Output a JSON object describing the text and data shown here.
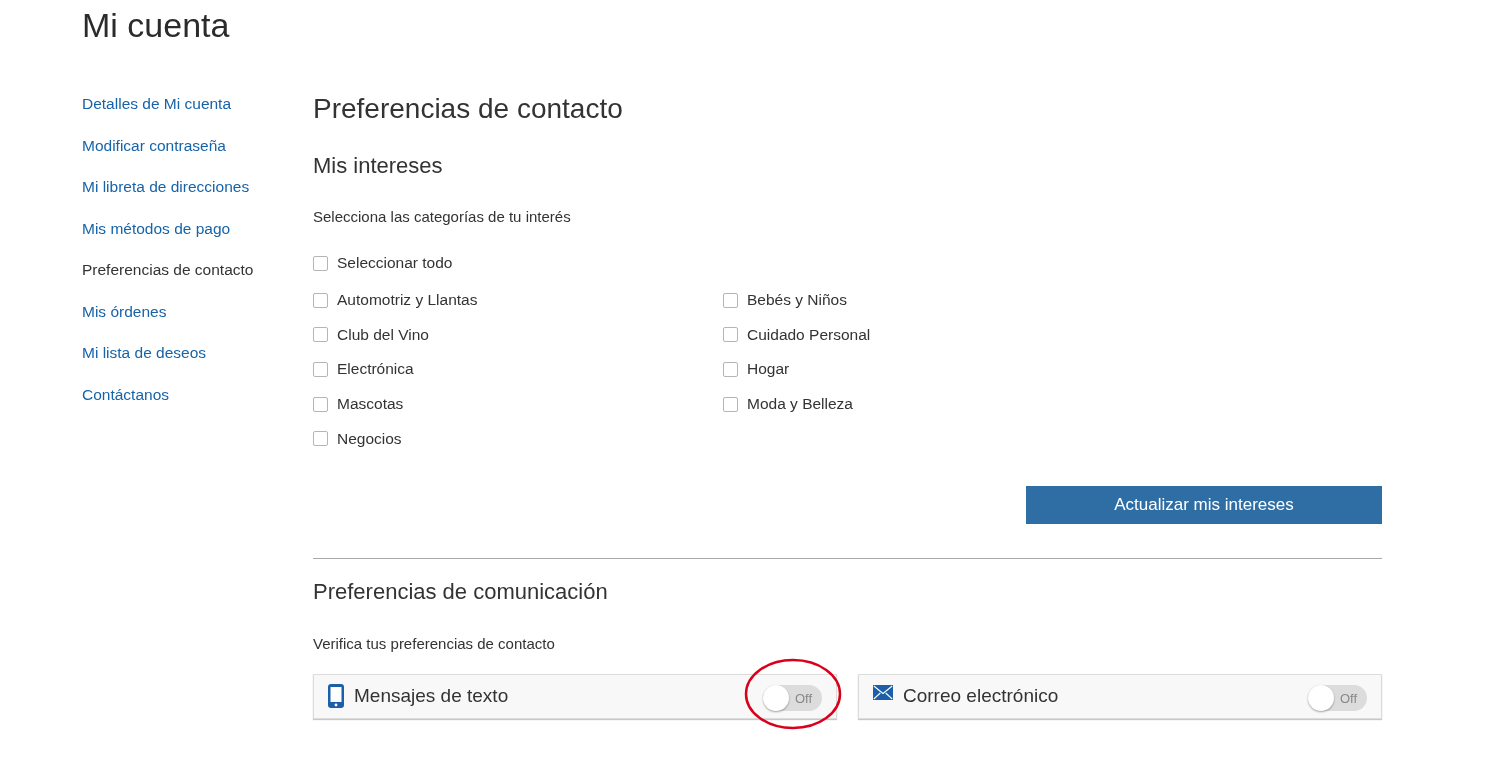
{
  "page": {
    "title": "Mi cuenta"
  },
  "sidebar": {
    "items": [
      {
        "label": "Detalles de Mi cuenta",
        "selected": false
      },
      {
        "label": "Modificar contraseña",
        "selected": false
      },
      {
        "label": "Mi libreta de direcciones",
        "selected": false
      },
      {
        "label": "Mis métodos de pago",
        "selected": false
      },
      {
        "label": "Preferencias de contacto",
        "selected": true
      },
      {
        "label": "Mis órdenes",
        "selected": false
      },
      {
        "label": "Mi lista de deseos",
        "selected": false
      },
      {
        "label": "Contáctanos",
        "selected": false
      }
    ]
  },
  "contact_preferences": {
    "title": "Preferencias de contacto",
    "interests": {
      "title": "Mis intereses",
      "instructions": "Selecciona las categorías de tu interés",
      "select_all": {
        "label": "Seleccionar todo",
        "checked": false
      },
      "categories": [
        {
          "label": "Automotriz y Llantas",
          "checked": false
        },
        {
          "label": "Bebés y Niños",
          "checked": false
        },
        {
          "label": "Club del Vino",
          "checked": false
        },
        {
          "label": "Cuidado Personal",
          "checked": false
        },
        {
          "label": "Electrónica",
          "checked": false
        },
        {
          "label": "Hogar",
          "checked": false
        },
        {
          "label": "Mascotas",
          "checked": false
        },
        {
          "label": "Moda y Belleza",
          "checked": false
        },
        {
          "label": "Negocios",
          "checked": false
        }
      ],
      "update_button": "Actualizar mis intereses"
    },
    "communication": {
      "title": "Preferencias de comunicación",
      "instructions": "Verifica tus preferencias de contacto",
      "channels": [
        {
          "kind": "phone",
          "label": "Mensajes de texto",
          "on": false,
          "state_label": "Off",
          "highlighted": true
        },
        {
          "kind": "mail",
          "label": "Correo electrónico",
          "on": false,
          "state_label": "Off",
          "highlighted": false
        }
      ]
    }
  }
}
